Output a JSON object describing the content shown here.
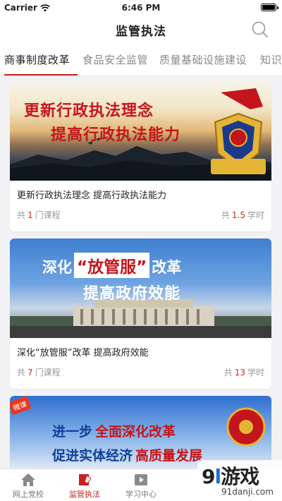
{
  "status_bar": {
    "carrier": "Carrier",
    "time": "6:46 PM"
  },
  "nav": {
    "title": "监管执法",
    "search_icon": "search-icon"
  },
  "tabs": [
    {
      "label": "商事制度改革",
      "active": true
    },
    {
      "label": "食品安全监管",
      "active": false
    },
    {
      "label": "质量基础设施建设",
      "active": false
    },
    {
      "label": "知识",
      "active": false
    }
  ],
  "courses": [
    {
      "banner_line1": "更新行政执法理念",
      "banner_line2": "提高行政执法能力",
      "title": "更新行政执法理念 提高行政执法能力",
      "count_prefix": "共",
      "count": "1",
      "count_suffix": "门课程",
      "hours_prefix": "共",
      "hours": "1.5",
      "hours_suffix": "学时"
    },
    {
      "banner_line1_a": "深化",
      "banner_line1_b": "“放管服”",
      "banner_line1_c": "改革",
      "banner_line2": "提高政府效能",
      "title": "深化“放管服”改革 提高政府效能",
      "count_prefix": "共",
      "count": "7",
      "count_suffix": "门课程",
      "hours_prefix": "共",
      "hours": "13",
      "hours_suffix": "学时"
    },
    {
      "badge": "微课",
      "banner_line1_a": "进一步",
      "banner_line1_b": "全面深化改革",
      "banner_line2_a": "促进实体经济",
      "banner_line2_b": "高质量发展"
    }
  ],
  "tabbar": [
    {
      "label": "网上党校",
      "icon": "home-icon",
      "active": false
    },
    {
      "label": "监管执法",
      "icon": "book-icon",
      "active": true
    },
    {
      "label": "学习中心",
      "icon": "play-icon",
      "active": false
    }
  ],
  "watermark": {
    "num": "9",
    "l": "l",
    "text": "游戏",
    "domain": "91danji.com"
  },
  "colors": {
    "accent": "#cc1f1f",
    "banner_blue": "#1f5fc0"
  }
}
